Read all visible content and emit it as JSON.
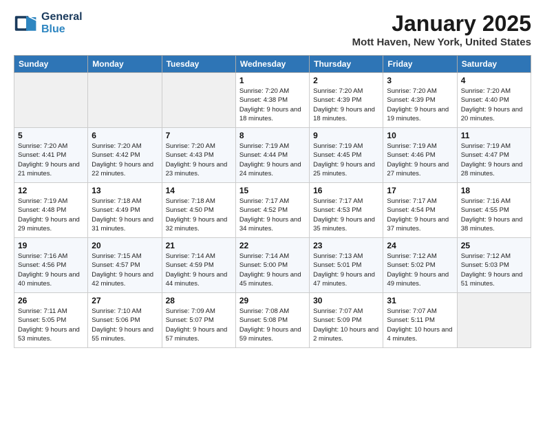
{
  "logo": {
    "line1": "General",
    "line2": "Blue"
  },
  "header": {
    "month": "January 2025",
    "location": "Mott Haven, New York, United States"
  },
  "days_of_week": [
    "Sunday",
    "Monday",
    "Tuesday",
    "Wednesday",
    "Thursday",
    "Friday",
    "Saturday"
  ],
  "weeks": [
    [
      {
        "day": "",
        "empty": true
      },
      {
        "day": "",
        "empty": true
      },
      {
        "day": "",
        "empty": true
      },
      {
        "day": "1",
        "sunrise": "7:20 AM",
        "sunset": "4:38 PM",
        "daylight": "9 hours and 18 minutes."
      },
      {
        "day": "2",
        "sunrise": "7:20 AM",
        "sunset": "4:39 PM",
        "daylight": "9 hours and 18 minutes."
      },
      {
        "day": "3",
        "sunrise": "7:20 AM",
        "sunset": "4:39 PM",
        "daylight": "9 hours and 19 minutes."
      },
      {
        "day": "4",
        "sunrise": "7:20 AM",
        "sunset": "4:40 PM",
        "daylight": "9 hours and 20 minutes."
      }
    ],
    [
      {
        "day": "5",
        "sunrise": "7:20 AM",
        "sunset": "4:41 PM",
        "daylight": "9 hours and 21 minutes."
      },
      {
        "day": "6",
        "sunrise": "7:20 AM",
        "sunset": "4:42 PM",
        "daylight": "9 hours and 22 minutes."
      },
      {
        "day": "7",
        "sunrise": "7:20 AM",
        "sunset": "4:43 PM",
        "daylight": "9 hours and 23 minutes."
      },
      {
        "day": "8",
        "sunrise": "7:19 AM",
        "sunset": "4:44 PM",
        "daylight": "9 hours and 24 minutes."
      },
      {
        "day": "9",
        "sunrise": "7:19 AM",
        "sunset": "4:45 PM",
        "daylight": "9 hours and 25 minutes."
      },
      {
        "day": "10",
        "sunrise": "7:19 AM",
        "sunset": "4:46 PM",
        "daylight": "9 hours and 27 minutes."
      },
      {
        "day": "11",
        "sunrise": "7:19 AM",
        "sunset": "4:47 PM",
        "daylight": "9 hours and 28 minutes."
      }
    ],
    [
      {
        "day": "12",
        "sunrise": "7:19 AM",
        "sunset": "4:48 PM",
        "daylight": "9 hours and 29 minutes."
      },
      {
        "day": "13",
        "sunrise": "7:18 AM",
        "sunset": "4:49 PM",
        "daylight": "9 hours and 31 minutes."
      },
      {
        "day": "14",
        "sunrise": "7:18 AM",
        "sunset": "4:50 PM",
        "daylight": "9 hours and 32 minutes."
      },
      {
        "day": "15",
        "sunrise": "7:17 AM",
        "sunset": "4:52 PM",
        "daylight": "9 hours and 34 minutes."
      },
      {
        "day": "16",
        "sunrise": "7:17 AM",
        "sunset": "4:53 PM",
        "daylight": "9 hours and 35 minutes."
      },
      {
        "day": "17",
        "sunrise": "7:17 AM",
        "sunset": "4:54 PM",
        "daylight": "9 hours and 37 minutes."
      },
      {
        "day": "18",
        "sunrise": "7:16 AM",
        "sunset": "4:55 PM",
        "daylight": "9 hours and 38 minutes."
      }
    ],
    [
      {
        "day": "19",
        "sunrise": "7:16 AM",
        "sunset": "4:56 PM",
        "daylight": "9 hours and 40 minutes."
      },
      {
        "day": "20",
        "sunrise": "7:15 AM",
        "sunset": "4:57 PM",
        "daylight": "9 hours and 42 minutes."
      },
      {
        "day": "21",
        "sunrise": "7:14 AM",
        "sunset": "4:59 PM",
        "daylight": "9 hours and 44 minutes."
      },
      {
        "day": "22",
        "sunrise": "7:14 AM",
        "sunset": "5:00 PM",
        "daylight": "9 hours and 45 minutes."
      },
      {
        "day": "23",
        "sunrise": "7:13 AM",
        "sunset": "5:01 PM",
        "daylight": "9 hours and 47 minutes."
      },
      {
        "day": "24",
        "sunrise": "7:12 AM",
        "sunset": "5:02 PM",
        "daylight": "9 hours and 49 minutes."
      },
      {
        "day": "25",
        "sunrise": "7:12 AM",
        "sunset": "5:03 PM",
        "daylight": "9 hours and 51 minutes."
      }
    ],
    [
      {
        "day": "26",
        "sunrise": "7:11 AM",
        "sunset": "5:05 PM",
        "daylight": "9 hours and 53 minutes."
      },
      {
        "day": "27",
        "sunrise": "7:10 AM",
        "sunset": "5:06 PM",
        "daylight": "9 hours and 55 minutes."
      },
      {
        "day": "28",
        "sunrise": "7:09 AM",
        "sunset": "5:07 PM",
        "daylight": "9 hours and 57 minutes."
      },
      {
        "day": "29",
        "sunrise": "7:08 AM",
        "sunset": "5:08 PM",
        "daylight": "9 hours and 59 minutes."
      },
      {
        "day": "30",
        "sunrise": "7:07 AM",
        "sunset": "5:09 PM",
        "daylight": "10 hours and 2 minutes."
      },
      {
        "day": "31",
        "sunrise": "7:07 AM",
        "sunset": "5:11 PM",
        "daylight": "10 hours and 4 minutes."
      },
      {
        "day": "",
        "empty": true
      }
    ]
  ]
}
